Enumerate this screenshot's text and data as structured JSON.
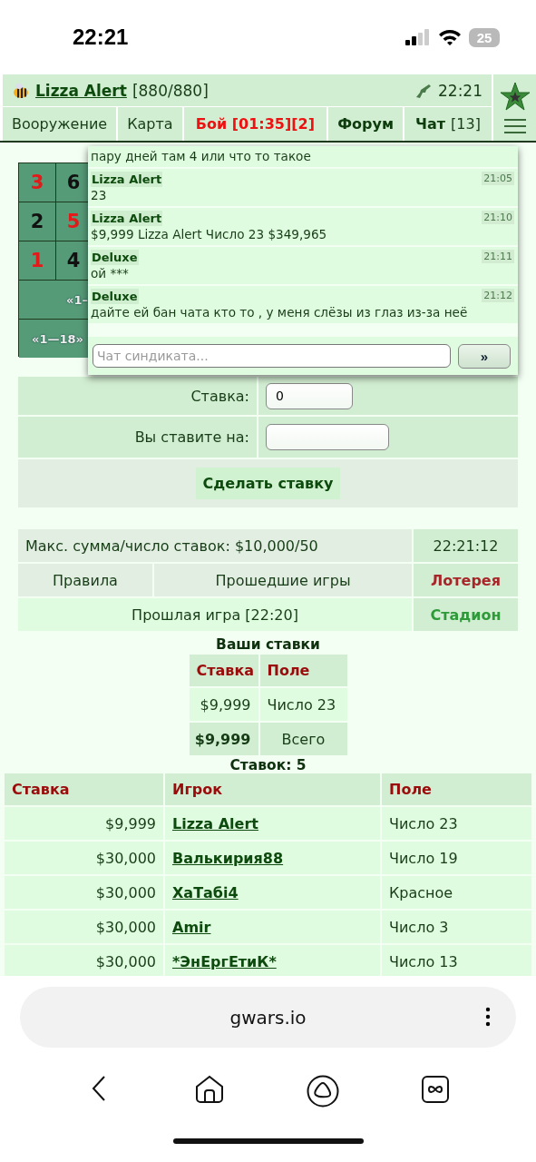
{
  "status_bar": {
    "time": "22:21",
    "battery": "25"
  },
  "header": {
    "player": "Lizza Alert",
    "hp": "[880/880]",
    "time": "22:21"
  },
  "nav_tabs": [
    {
      "label": "Вооружение",
      "kind": "plain"
    },
    {
      "label": "Карта",
      "kind": "plain"
    },
    {
      "label": "Бой [01:35][2]",
      "kind": "alert"
    },
    {
      "label": "Форум",
      "kind": "bold"
    },
    {
      "label": "Чат",
      "count": "[13]",
      "kind": "bold"
    }
  ],
  "roulette": {
    "rows": [
      [
        {
          "label": "3",
          "color": "#e21a1a"
        },
        {
          "label": "6",
          "color": "#111111"
        }
      ],
      [
        {
          "label": "2",
          "color": "#111111"
        },
        {
          "label": "5",
          "color": "#e21a1a"
        }
      ],
      [
        {
          "label": "1",
          "color": "#e21a1a"
        },
        {
          "label": "4",
          "color": "#111111"
        }
      ]
    ],
    "wide": [
      "«1–",
      "«1—18»"
    ]
  },
  "chat": {
    "messages": [
      {
        "text": "пару дней там 4 или что то такое"
      },
      {
        "author": "Lizza Alert",
        "time": "21:05",
        "text": "23"
      },
      {
        "author": "Lizza Alert",
        "time": "21:10",
        "text": "$9,999 Lizza Alert Число 23 $349,965"
      },
      {
        "author": "Deluxe",
        "time": "21:11",
        "text": "ой ***"
      },
      {
        "author": "Deluxe",
        "time": "21:12",
        "text": "дайте ей бан чата кто то , у меня слёзы из глаз из-за неё"
      }
    ],
    "input": {
      "placeholder": "Чат синдиката..."
    },
    "send": "»"
  },
  "bet_form": {
    "fields": [
      {
        "label": "Ставка:",
        "value": "0"
      },
      {
        "label": "Вы ставите на:"
      }
    ],
    "submit": "Сделать ставку"
  },
  "info": {
    "limits": "Макс. сумма/число ставок: $10,000/50",
    "clock": "22:21:12",
    "links": [
      "Правила",
      "Прошедшие игры"
    ],
    "last_game": "Прошлая игра [22:20]",
    "games": [
      {
        "label": "Лотерея",
        "color": "#a8262a"
      },
      {
        "label": "Стадион",
        "color": "#2e9a3a"
      }
    ]
  },
  "my_bets": {
    "title": "Ваши ставки",
    "columns": [
      "Ставка",
      "Поле"
    ],
    "rows": [
      [
        "$9,999",
        "Число 23"
      ]
    ],
    "total": {
      "amount": "$9,999",
      "label": "Всего"
    }
  },
  "all_bets": {
    "title": "Ставок: 5",
    "columns": [
      "Ставка",
      "Игрок",
      "Поле"
    ],
    "rows": [
      {
        "amount": "$9,999",
        "player": "Lizza Alert",
        "field": "Число 23"
      },
      {
        "amount": "$30,000",
        "player": "Валькирия88",
        "field": "Число 19"
      },
      {
        "amount": "$30,000",
        "player": "ХаТабі4",
        "field": "Красное"
      },
      {
        "amount": "$30,000",
        "player": "Amir",
        "field": "Число 3"
      },
      {
        "amount": "$30,000",
        "player": "*ЭнЕргЕтиК*",
        "field": "Число 13"
      }
    ]
  },
  "browser": {
    "url": "gwars.io"
  }
}
